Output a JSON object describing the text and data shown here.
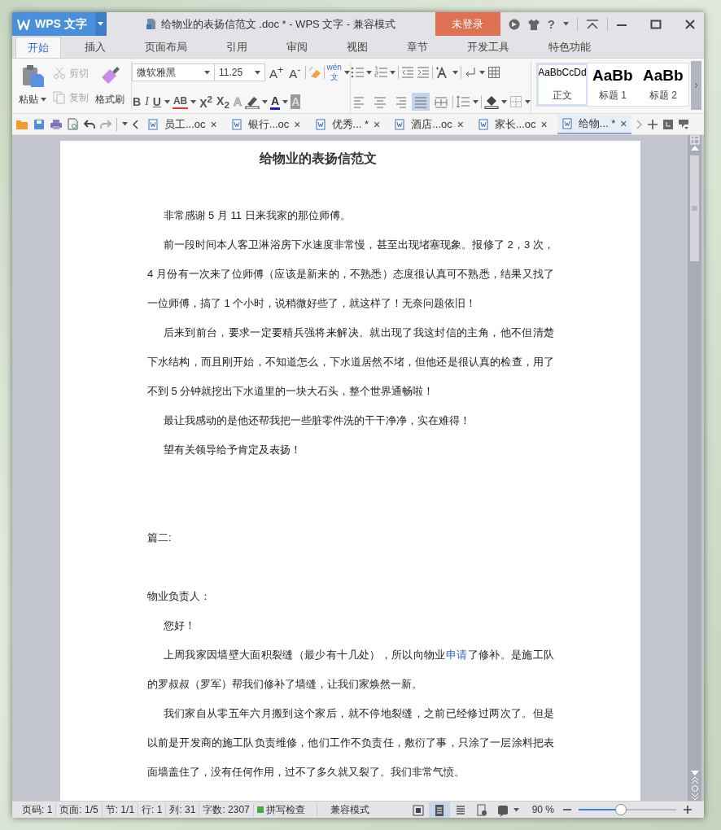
{
  "title_bar": {
    "app_name": "WPS 文字",
    "document_title": "给物业的表扬信范文 .doc * - WPS 文字 - 兼容模式",
    "login_button": "未登录",
    "help_label": "?"
  },
  "menu_tabs": [
    {
      "label": "开始",
      "selected": true
    },
    {
      "label": "插入",
      "selected": false
    },
    {
      "label": "页面布局",
      "selected": false
    },
    {
      "label": "引用",
      "selected": false
    },
    {
      "label": "审阅",
      "selected": false
    },
    {
      "label": "视图",
      "selected": false
    },
    {
      "label": "章节",
      "selected": false
    },
    {
      "label": "开发工具",
      "selected": false
    },
    {
      "label": "特色功能",
      "selected": false
    }
  ],
  "clipboard": {
    "paste": "粘贴",
    "cut": {
      "label": "剪切",
      "disabled": true
    },
    "copy": {
      "label": "复制",
      "disabled": true
    },
    "format_painter": "格式刷"
  },
  "font": {
    "family": "微软雅黑",
    "size": "11.25",
    "grow": "A$^{+}$",
    "shrink": "A$^{-}$",
    "pinyin_top": "wén",
    "pinyin_bottom": "文",
    "format_buttons": [
      {
        "kind": "bold",
        "label": "B"
      },
      {
        "kind": "italic",
        "label": "I"
      },
      {
        "kind": "underline",
        "label": "U"
      },
      {
        "kind": "strike",
        "label": "AB"
      },
      {
        "kind": "script",
        "label": "X$^{2}$"
      },
      {
        "kind": "script",
        "label": "X$_{2}$"
      },
      {
        "kind": "effect",
        "label": "A"
      },
      {
        "kind": "highlight"
      },
      {
        "kind": "color",
        "label": "A"
      },
      {
        "kind": "shade",
        "label": "A"
      }
    ]
  },
  "align_buttons": [
    {
      "selected": false
    },
    {
      "selected": false
    },
    {
      "selected": false
    },
    {
      "selected": true
    },
    {
      "selected": false
    }
  ],
  "styles": [
    {
      "preview": "AaBbCcDd",
      "name": "正文",
      "selected": true
    },
    {
      "preview": "AaBb",
      "name": "标题 1",
      "selected": false
    },
    {
      "preview": "AaBb",
      "name": "标题 2",
      "selected": false
    }
  ],
  "doc_tabs": [
    {
      "title": "员工...oc",
      "close": "×",
      "selected": false
    },
    {
      "title": "银行...oc",
      "close": "×",
      "selected": false
    },
    {
      "title": "优秀... *",
      "close": "×",
      "selected": false
    },
    {
      "title": "酒店...oc",
      "close": "×",
      "selected": false
    },
    {
      "title": "家长...oc",
      "close": "×",
      "selected": false
    },
    {
      "title": "给物... *",
      "close": "×",
      "selected": true
    }
  ],
  "document": {
    "title": "给物业的表扬信范文",
    "paragraphs": [
      {
        "kind": "indent",
        "text": "非常感谢 5 月 11 日来我家的那位师傅。"
      },
      {
        "kind": "indent",
        "text": "前一段时间本人客卫淋浴房下水速度非常慢，甚至出现堵塞现象。报修了 2，3 次，4 月份有一次来了位师傅（应该是新来的，不熟悉）态度很认真可不熟悉，结果又找了一位师傅，搞了 1 个小时，说稍微好些了，就这样了！无奈问题依旧！"
      },
      {
        "kind": "indent",
        "text": "后来到前台，要求一定要精兵强将来解决。就出现了我这封信的主角，他不但清楚下水结构，而且刚开始，不知道怎么，下水道居然不堵，但他还是很认真的检查，用了不到 5 分钟就挖出下水道里的一块大石头，整个世界通畅啦！"
      },
      {
        "kind": "indent",
        "text": "最让我感动的是他还帮我把一些脏零件洗的干干净净，实在难得！"
      },
      {
        "kind": "indent",
        "text": "望有关领导给予肯定及表扬！"
      },
      {
        "kind": "blank"
      },
      {
        "kind": "blank"
      },
      {
        "kind": "plain",
        "text": "篇二:"
      },
      {
        "kind": "blank"
      },
      {
        "kind": "plain",
        "text": "物业负责人："
      },
      {
        "kind": "indent",
        "text": "您好！"
      },
      {
        "kind": "indent",
        "text": "上周我家因墙壁大面积裂缝（最少有十几处），所以向物业",
        "link": "申请",
        "text_after": "了修补。是施工队的罗叔叔（罗军）帮我们修补了墙缝，让我们家焕然一新。"
      },
      {
        "kind": "indent",
        "text": "我们家自从零五年六月搬到这个家后，就不停地裂缝，之前已经修过两次了。但是以前是开发商的施工队负责维修，他们工作不负责任，敷衍了事，只涂了一层涂料把表面墙盖住了，没有任何作用，过不了多久就又裂了。我们非常气愤。"
      }
    ]
  },
  "status_bar": {
    "items": [
      "页码: 1",
      "页面: 1/5",
      "节: 1/1",
      "行: 1",
      "列: 31",
      "字数: 2307"
    ],
    "spell_check": {
      "label": "拼写检查",
      "on": true
    },
    "mode": "兼容模式",
    "view_buttons": [
      {
        "selected": false
      },
      {
        "selected": true
      },
      {
        "selected": false
      },
      {
        "selected": false
      },
      {
        "selected": false
      }
    ],
    "zoom": "90 %",
    "zoom_slider": {
      "level": 0.43
    }
  }
}
